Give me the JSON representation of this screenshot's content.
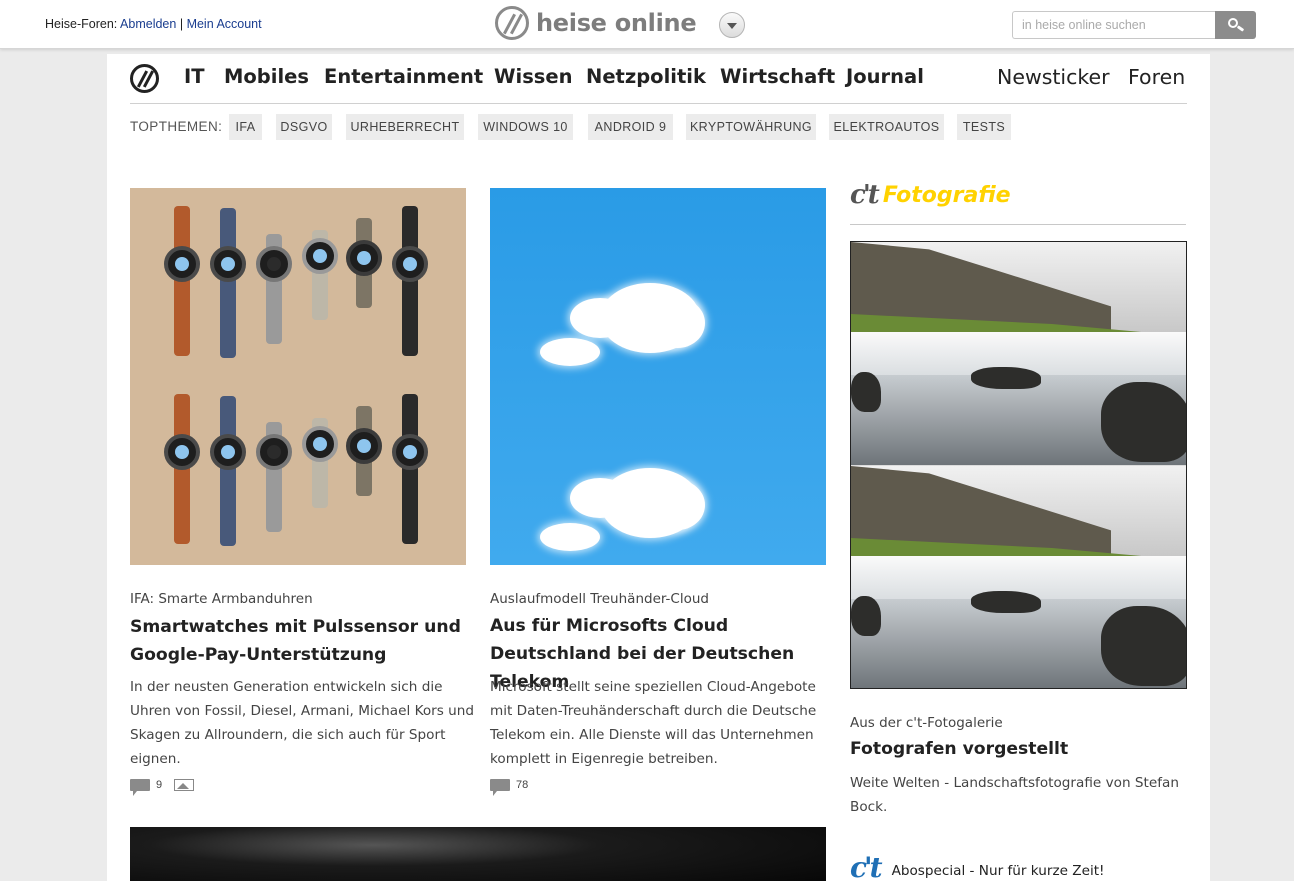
{
  "topbar": {
    "forum_prefix": "Heise-Foren:",
    "logout_label": "Abmelden",
    "separator": "|",
    "account_label": "Mein Account",
    "brand": "heise online",
    "search_placeholder": "in heise online suchen",
    "icons": [
      "heise-logo-icon",
      "chevron-down-icon",
      "search-icon"
    ]
  },
  "nav": {
    "items": [
      "IT",
      "Mobiles",
      "Entertainment",
      "Wissen",
      "Netzpolitik",
      "Wirtschaft",
      "Journal"
    ],
    "right": [
      "Newsticker",
      "Foren"
    ]
  },
  "topthemen": {
    "label": "TOPTHEMEN:",
    "tags": [
      "IFA",
      "DSGVO",
      "URHEBERRECHT",
      "WINDOWS 10",
      "ANDROID 9",
      "KRYPTOWÄHRUNG",
      "ELEKTROAUTOS",
      "TESTS"
    ]
  },
  "articles": [
    {
      "kicker": "IFA: Smarte Armbanduhren",
      "headline": "Smartwatches mit Pulssensor und Google-Pay-Unterstützung",
      "teaser": "In der neusten Generation entwickeln sich die Uhren von Fossil, Diesel, Armani, Michael Kors und Skagen zu Allroundern, die sich auch für Sport eignen.",
      "comments": "9",
      "has_gallery": true
    },
    {
      "kicker": "Auslaufmodell Treuhänder-Cloud",
      "headline": "Aus für Microsofts Cloud Deutschland bei der Deutschen Telekom",
      "teaser": "Microsoft stellt seine speziellen Cloud-Angebote mit Daten-Treuhänderschaft durch die Deutsche Telekom ein. Alle Dienste will das Unternehmen komplett in Eigenregie betreiben.",
      "comments": "78",
      "has_gallery": false
    }
  ],
  "sidebar": {
    "brand_logo": "c't",
    "brand_sub": "Fotografie",
    "kicker": "Aus der c't-Fotogalerie",
    "headline": "Fotografen vorgestellt",
    "teaser": "Weite Welten - Landschaftsfotografie von Stefan Bock.",
    "abo_logo": "c't",
    "abo_text": "Abospecial - Nur für kurze Zeit!"
  },
  "colors": {
    "link": "#1a3d8f",
    "ct_yellow": "#ffd200",
    "ct_blue": "#1f6fb5",
    "sky_blue": "#2a9be6"
  }
}
